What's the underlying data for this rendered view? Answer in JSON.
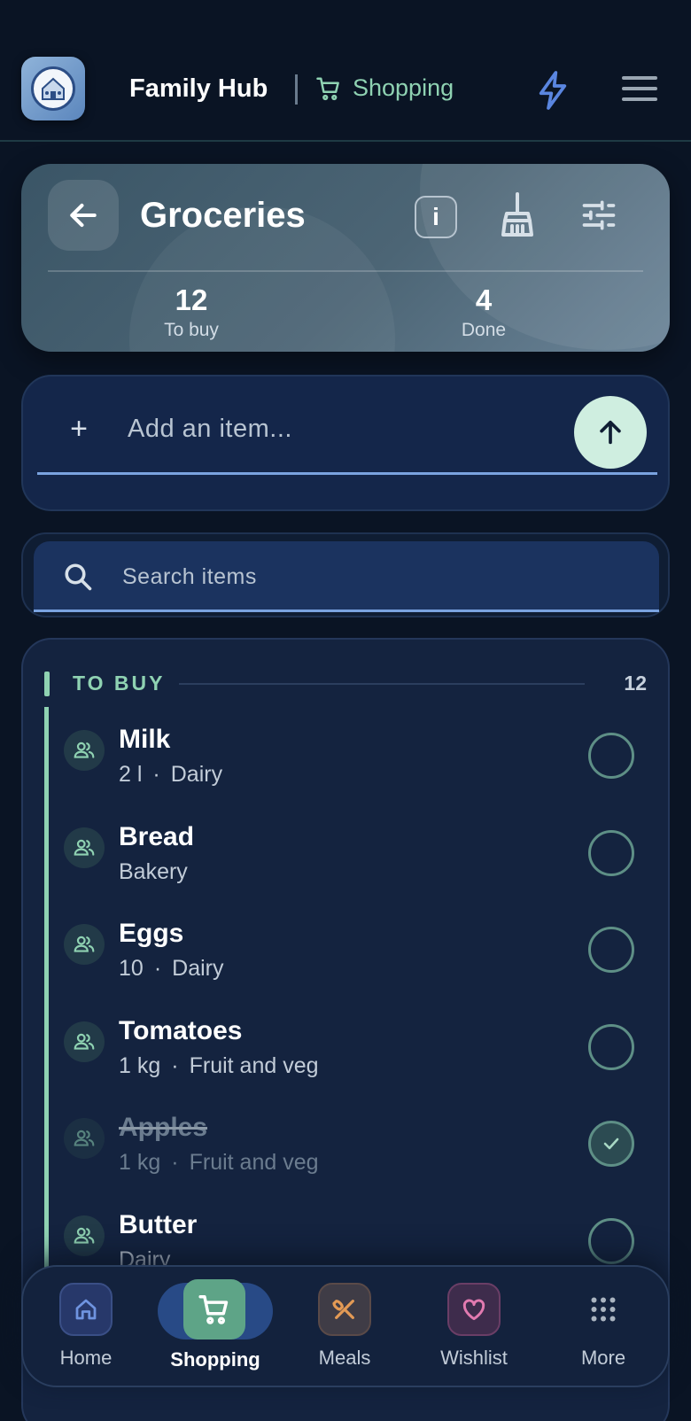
{
  "header": {
    "app_title": "Family Hub",
    "section_label": "Shopping",
    "logo_icon": "family-house-logo",
    "actions": [
      "bolt-icon",
      "menu-icon"
    ]
  },
  "list_card": {
    "title": "Groceries",
    "stats": [
      {
        "value": "12",
        "label": "To buy"
      },
      {
        "value": "4",
        "label": "Done"
      }
    ]
  },
  "add_item": {
    "placeholder": "Add an item...",
    "value": ""
  },
  "search": {
    "placeholder": "Search items",
    "value": ""
  },
  "to_buy": {
    "label": "TO BUY",
    "count": "12",
    "items": [
      {
        "name": "Milk",
        "qty": "2 l",
        "category": "Dairy",
        "checked": false
      },
      {
        "name": "Bread",
        "qty": "",
        "category": "Bakery",
        "checked": false
      },
      {
        "name": "Eggs",
        "qty": "10",
        "category": "Dairy",
        "checked": false
      },
      {
        "name": "Tomatoes",
        "qty": "1 kg",
        "category": "Fruit and veg",
        "checked": false
      },
      {
        "name": "Apples",
        "qty": "1 kg",
        "category": "Fruit and veg",
        "checked": true
      },
      {
        "name": "Butter",
        "qty": "",
        "category": "Dairy",
        "checked": false
      }
    ]
  },
  "nav": {
    "items": [
      {
        "label": "Home",
        "icon": "home-icon"
      },
      {
        "label": "Shopping",
        "icon": "cart-icon"
      },
      {
        "label": "Meals",
        "icon": "utensils-icon"
      },
      {
        "label": "Wishlist",
        "icon": "heart-icon"
      },
      {
        "label": "More",
        "icon": "grid-icon"
      }
    ],
    "active": "Shopping"
  },
  "colors": {
    "accent_green": "#8fd2b2",
    "accent_blue": "#7aa3e0",
    "background": "#0a1424"
  }
}
